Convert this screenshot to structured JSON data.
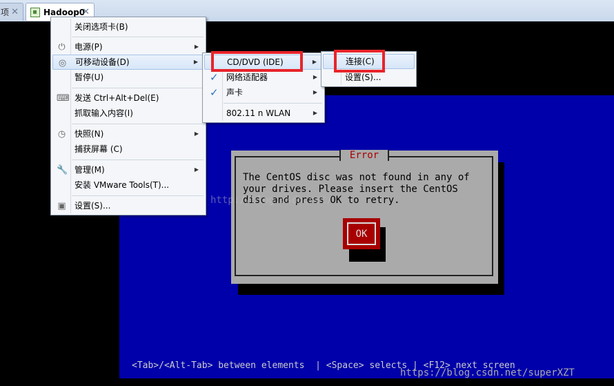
{
  "tabs": [
    {
      "label": "项",
      "close": "✕"
    },
    {
      "label": "Hadoop0",
      "close": "✕"
    }
  ],
  "main_menu": {
    "items": [
      {
        "label": "关闭选项卡(B)"
      },
      {
        "label": "电源(P)",
        "icon": "power-icon"
      },
      {
        "label": "可移动设备(D)",
        "icon": "cd-icon"
      },
      {
        "label": "暂停(U)"
      },
      {
        "label": "发送 Ctrl+Alt+Del(E)",
        "icon": "keyboard-icon"
      },
      {
        "label": "抓取输入内容(I)"
      },
      {
        "label": "快照(N)",
        "icon": "snapshot-icon"
      },
      {
        "label": "捕获屏幕 (C)"
      },
      {
        "label": "管理(M)",
        "icon": "wrench-icon"
      },
      {
        "label": "安装 VMware Tools(T)..."
      },
      {
        "label": "设置(S)...",
        "icon": "settings-icon"
      }
    ]
  },
  "removable_menu": {
    "items": [
      {
        "label": "CD/DVD (IDE)"
      },
      {
        "label": "网络适配器",
        "checked": true
      },
      {
        "label": "声卡",
        "checked": true
      },
      {
        "label": "802.11 n WLAN"
      }
    ]
  },
  "cd_menu": {
    "items": [
      {
        "label": "连接(C)"
      },
      {
        "label": "设置(S)..."
      }
    ]
  },
  "console": {
    "error_title": "Error",
    "error_message": "The CentOS disc was not found in any of\nyour drives. Please insert the CentOS\ndisc and press OK to retry.",
    "ok_label": "OK",
    "hint": "<Tab>/<Alt-Tab> between elements  | <Space> selects | <F12> next screen"
  },
  "watermarks": {
    "center": "http://blog.csdn.net/",
    "corner": "https://blog.csdn.net/superXZT"
  },
  "colors": {
    "highlight_box": "#e8242b",
    "console_blue": "#0000aa",
    "ok_red": "#a80000",
    "error_title": "#aa0000"
  }
}
